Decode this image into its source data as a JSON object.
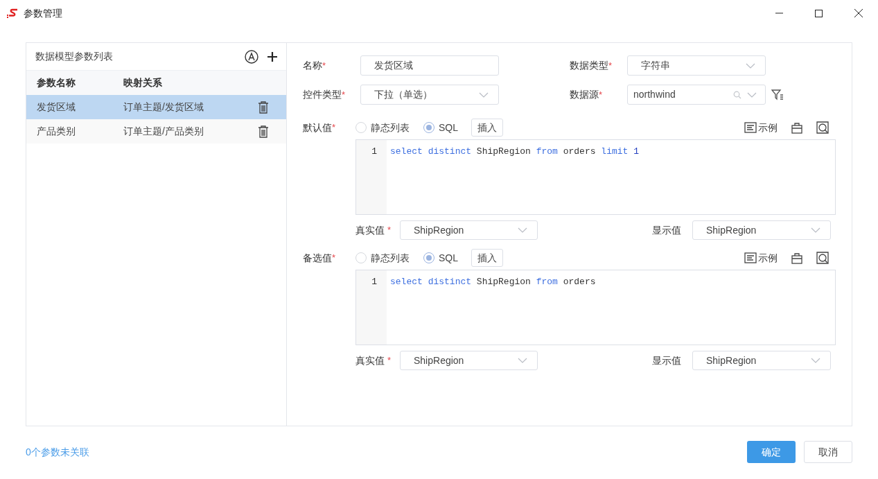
{
  "window": {
    "title": "参数管理"
  },
  "param_list": {
    "title": "数据模型参数列表",
    "columns": [
      "参数名称",
      "映射关系"
    ],
    "rows": [
      {
        "name": "发货区域",
        "mapping": "订单主题/发货区域",
        "selected": true
      },
      {
        "name": "产品类别",
        "mapping": "订单主题/产品类别",
        "selected": false
      }
    ]
  },
  "form": {
    "fields": [
      {
        "label": "名称",
        "required_mark": "*",
        "kind": "input",
        "value": "发货区域"
      },
      {
        "label": "数据类型",
        "required_mark": "*",
        "kind": "select",
        "value": "字符串"
      },
      {
        "label": "控件类型",
        "required_mark": "*",
        "kind": "select",
        "value": "下拉（单选）"
      },
      {
        "label": "数据源",
        "required_mark": "*",
        "kind": "search-select",
        "value": "northwind"
      }
    ],
    "sections": [
      {
        "label": "默认值",
        "required_mark": "*",
        "options": [
          {
            "label": "静态列表",
            "selected": false
          },
          {
            "label": "SQL",
            "selected": true
          }
        ],
        "insert": "插入",
        "example": "示例",
        "lines": [
          {
            "number": "1",
            "tokens": [
              {
                "text": "select",
                "kind": "keyword"
              },
              {
                "text": "distinct",
                "kind": "keyword"
              },
              {
                "text": "ShipRegion",
                "kind": "plain"
              },
              {
                "text": "from",
                "kind": "keyword"
              },
              {
                "text": "orders",
                "kind": "plain"
              },
              {
                "text": "limit",
                "kind": "keyword"
              },
              {
                "text": "1",
                "kind": "number"
              }
            ]
          }
        ],
        "true_value": {
          "label": "真实值",
          "required_mark": "*",
          "value": "ShipRegion"
        },
        "display_value": {
          "label": "显示值",
          "value": "ShipRegion"
        }
      },
      {
        "label": "备选值",
        "required_mark": "*",
        "options": [
          {
            "label": "静态列表",
            "selected": false
          },
          {
            "label": "SQL",
            "selected": true
          }
        ],
        "insert": "插入",
        "example": "示例",
        "lines": [
          {
            "number": "1",
            "tokens": [
              {
                "text": "select",
                "kind": "keyword"
              },
              {
                "text": "distinct",
                "kind": "keyword"
              },
              {
                "text": "ShipRegion",
                "kind": "plain"
              },
              {
                "text": "from",
                "kind": "keyword"
              },
              {
                "text": "orders",
                "kind": "plain"
              }
            ]
          }
        ],
        "true_value": {
          "label": "真实值",
          "required_mark": "*",
          "value": "ShipRegion"
        },
        "display_value": {
          "label": "显示值",
          "value": "ShipRegion"
        }
      }
    ]
  },
  "footer": {
    "link": "0个参数未关联",
    "buttons": [
      {
        "label": "确定",
        "kind": "primary"
      },
      {
        "label": "取消",
        "kind": "secondary"
      }
    ]
  }
}
